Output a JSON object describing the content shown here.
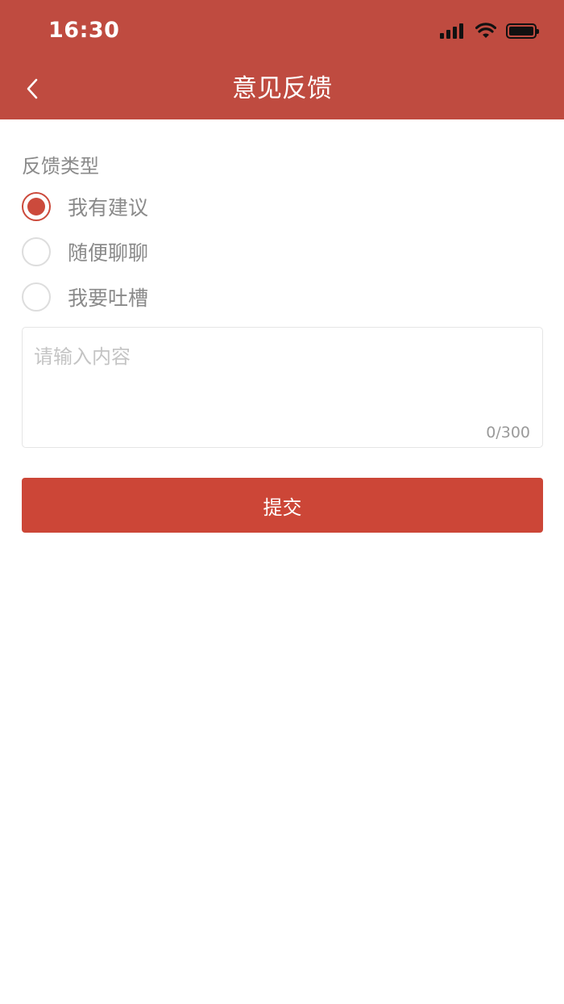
{
  "status_bar": {
    "time": "16:30"
  },
  "header": {
    "title": "意见反馈",
    "back_icon": "chevron-left-icon",
    "background_color": "#bf4b40"
  },
  "feedback_type": {
    "label": "反馈类型",
    "options": [
      {
        "label": "我有建议",
        "selected": true
      },
      {
        "label": "随便聊聊",
        "selected": false
      },
      {
        "label": "我要吐槽",
        "selected": false
      }
    ]
  },
  "content": {
    "placeholder": "请输入内容",
    "value": "",
    "counter": "0/300"
  },
  "submit": {
    "label": "提交",
    "color": "#cc4637"
  }
}
